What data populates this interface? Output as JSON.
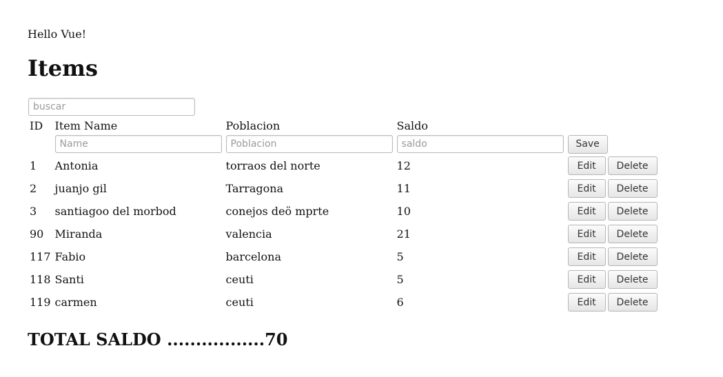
{
  "greeting": "Hello Vue!",
  "title": "Items",
  "search": {
    "placeholder": "buscar",
    "value": ""
  },
  "table": {
    "headers": {
      "id": "ID",
      "name": "Item Name",
      "poblacion": "Poblacion",
      "saldo": "Saldo"
    },
    "new_item": {
      "name_placeholder": "Name",
      "poblacion_placeholder": "Poblacion",
      "saldo_placeholder": "saldo",
      "save_label": "Save"
    },
    "rows": [
      {
        "id": "1",
        "name": "Antonia",
        "poblacion": "torraos del norte",
        "saldo": "12"
      },
      {
        "id": "2",
        "name": "juanjo gil",
        "poblacion": "Tarragona",
        "saldo": "11"
      },
      {
        "id": "3",
        "name": "santiagoo del morbod",
        "poblacion": "conejos deö mprte",
        "saldo": "10"
      },
      {
        "id": "90",
        "name": "Miranda",
        "poblacion": "valencia",
        "saldo": "21"
      },
      {
        "id": "117",
        "name": "Fabio",
        "poblacion": "barcelona",
        "saldo": "5"
      },
      {
        "id": "118",
        "name": "Santi",
        "poblacion": "ceuti",
        "saldo": "5"
      },
      {
        "id": "119",
        "name": "carmen",
        "poblacion": "ceuti",
        "saldo": "6"
      }
    ],
    "edit_label": "Edit",
    "delete_label": "Delete"
  },
  "total": "TOTAL SALDO .................70"
}
